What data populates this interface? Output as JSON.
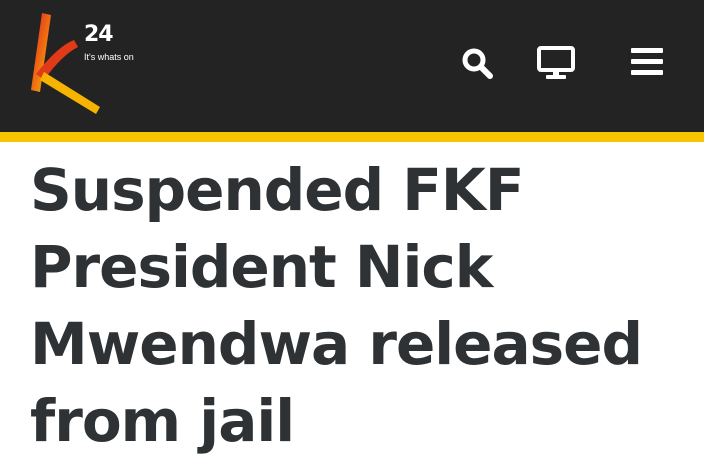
{
  "header": {
    "logo": {
      "number": "24",
      "tagline": "It's whats on",
      "colors": {
        "gradient_start": "#d81e1e",
        "gradient_end": "#f6c400"
      }
    },
    "background_color": "#232323",
    "accent_color": "#f6c400",
    "icons": {
      "search": "search-icon",
      "tv": "tv-icon",
      "menu": "menu-icon"
    }
  },
  "article": {
    "headline": "Suspended FKF President Nick Mwendwa released from jail"
  }
}
